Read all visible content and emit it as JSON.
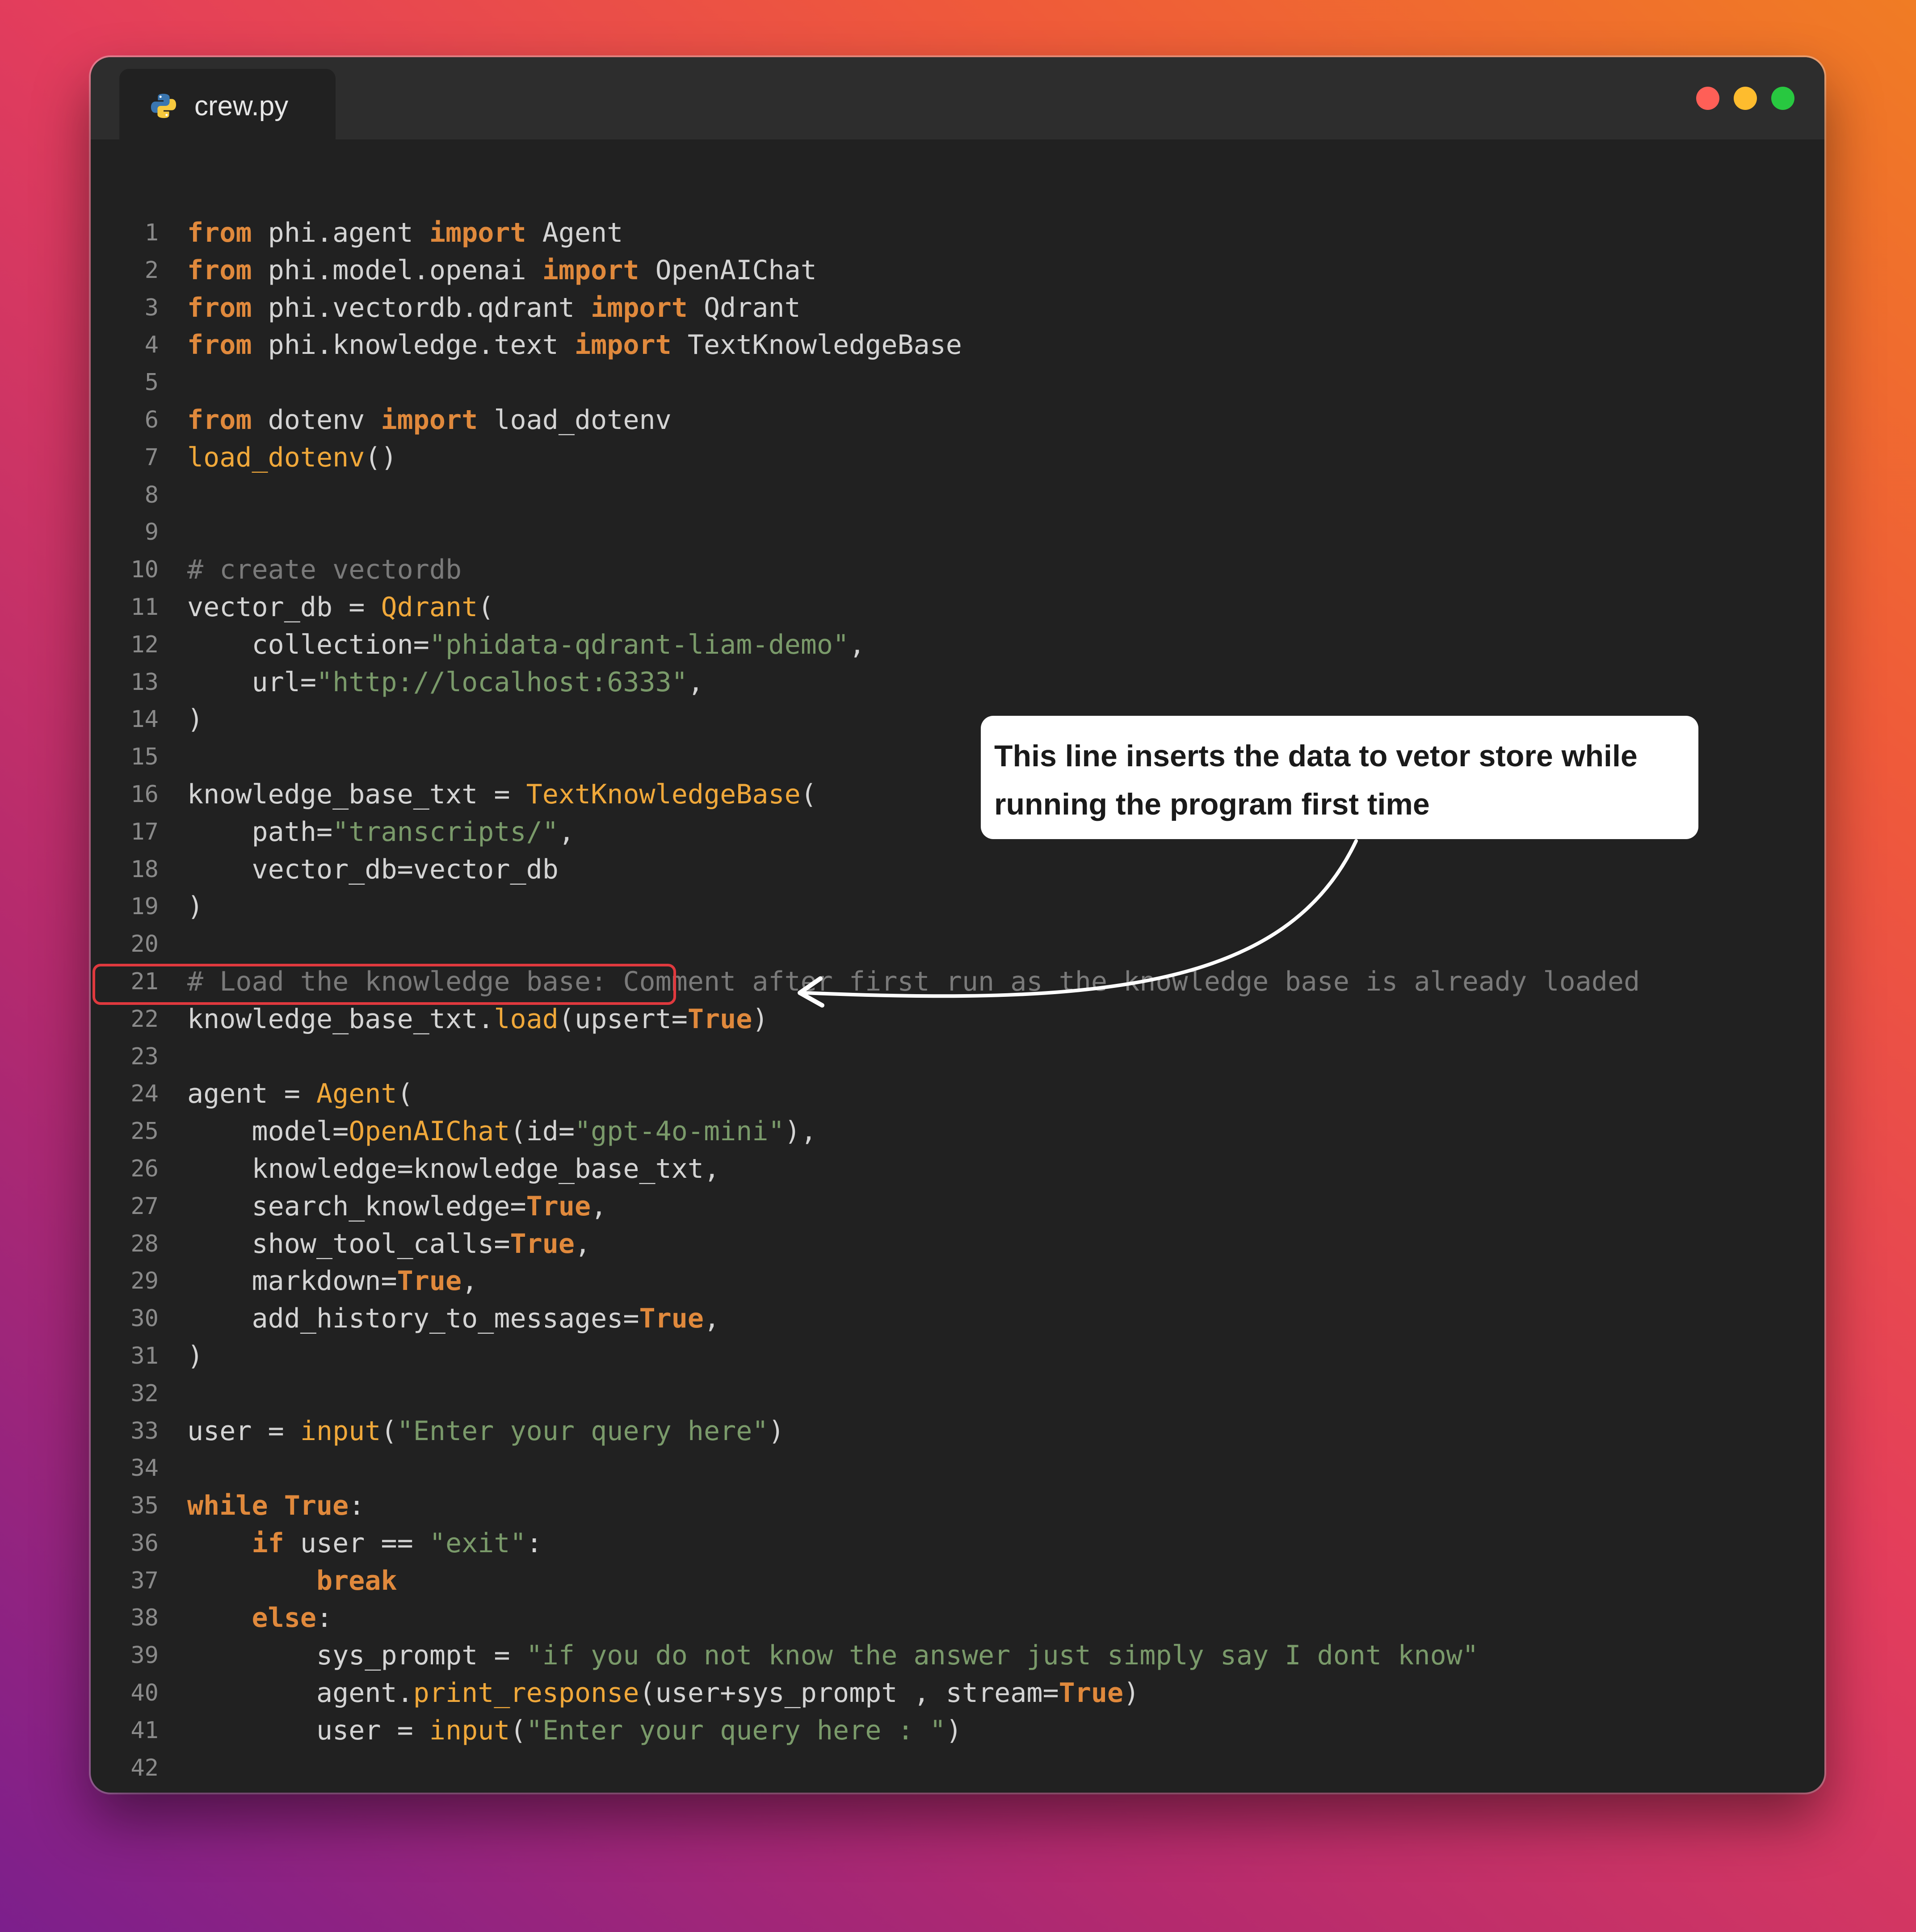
{
  "window": {
    "tab": {
      "filename": "crew.py",
      "icon": "python-icon"
    },
    "controls": {
      "close_color": "#ff5f57",
      "minimize_color": "#febc2e",
      "maximize_color": "#28c840"
    }
  },
  "editor": {
    "highlighted_line": 22,
    "lines": [
      {
        "n": "1",
        "tokens": [
          [
            "kw",
            "from"
          ],
          [
            "pl",
            " phi.agent "
          ],
          [
            "kw",
            "import"
          ],
          [
            "pl",
            " Agent"
          ]
        ]
      },
      {
        "n": "2",
        "tokens": [
          [
            "kw",
            "from"
          ],
          [
            "pl",
            " phi.model.openai "
          ],
          [
            "kw",
            "import"
          ],
          [
            "pl",
            " OpenAIChat"
          ]
        ]
      },
      {
        "n": "3",
        "tokens": [
          [
            "kw",
            "from"
          ],
          [
            "pl",
            " phi.vectordb.qdrant "
          ],
          [
            "kw",
            "import"
          ],
          [
            "pl",
            " Qdrant"
          ]
        ]
      },
      {
        "n": "4",
        "tokens": [
          [
            "kw",
            "from"
          ],
          [
            "pl",
            " phi.knowledge.text "
          ],
          [
            "kw",
            "import"
          ],
          [
            "pl",
            " TextKnowledgeBase"
          ]
        ]
      },
      {
        "n": "5",
        "tokens": []
      },
      {
        "n": "6",
        "tokens": [
          [
            "kw",
            "from"
          ],
          [
            "pl",
            " dotenv "
          ],
          [
            "kw",
            "import"
          ],
          [
            "pl",
            " load_dotenv"
          ]
        ]
      },
      {
        "n": "7",
        "tokens": [
          [
            "fn",
            "load_dotenv"
          ],
          [
            "pl",
            "()"
          ]
        ]
      },
      {
        "n": "8",
        "tokens": []
      },
      {
        "n": "9",
        "tokens": []
      },
      {
        "n": "10",
        "tokens": [
          [
            "cm",
            "# create vectordb"
          ]
        ]
      },
      {
        "n": "11",
        "tokens": [
          [
            "pl",
            "vector_db = "
          ],
          [
            "cls",
            "Qdrant"
          ],
          [
            "pl",
            "("
          ]
        ]
      },
      {
        "n": "12",
        "tokens": [
          [
            "pl",
            "    collection="
          ],
          [
            "str",
            "\"phidata-qdrant-liam-demo\""
          ],
          [
            "pl",
            ","
          ]
        ]
      },
      {
        "n": "13",
        "tokens": [
          [
            "pl",
            "    url="
          ],
          [
            "str",
            "\"http://localhost:6333\""
          ],
          [
            "pl",
            ","
          ]
        ]
      },
      {
        "n": "14",
        "tokens": [
          [
            "pl",
            ")"
          ]
        ]
      },
      {
        "n": "15",
        "tokens": []
      },
      {
        "n": "16",
        "tokens": [
          [
            "pl",
            "knowledge_base_txt = "
          ],
          [
            "cls",
            "TextKnowledgeBase"
          ],
          [
            "pl",
            "("
          ]
        ]
      },
      {
        "n": "17",
        "tokens": [
          [
            "pl",
            "    path="
          ],
          [
            "str",
            "\"transcripts/\""
          ],
          [
            "pl",
            ","
          ]
        ]
      },
      {
        "n": "18",
        "tokens": [
          [
            "pl",
            "    vector_db=vector_db"
          ]
        ]
      },
      {
        "n": "19",
        "tokens": [
          [
            "pl",
            ")"
          ]
        ]
      },
      {
        "n": "20",
        "tokens": []
      },
      {
        "n": "21",
        "tokens": [
          [
            "cm",
            "# Load the knowledge base: Comment after first run as the knowledge base is already loaded"
          ]
        ]
      },
      {
        "n": "22",
        "tokens": [
          [
            "pl",
            "knowledge_base_txt."
          ],
          [
            "fn",
            "load"
          ],
          [
            "pl",
            "(upsert="
          ],
          [
            "kw",
            "True"
          ],
          [
            "pl",
            ")"
          ]
        ]
      },
      {
        "n": "23",
        "tokens": []
      },
      {
        "n": "24",
        "tokens": [
          [
            "pl",
            "agent = "
          ],
          [
            "cls",
            "Agent"
          ],
          [
            "pl",
            "("
          ]
        ]
      },
      {
        "n": "25",
        "tokens": [
          [
            "pl",
            "    model="
          ],
          [
            "cls",
            "OpenAIChat"
          ],
          [
            "pl",
            "(id="
          ],
          [
            "str",
            "\"gpt-4o-mini\""
          ],
          [
            "pl",
            "),"
          ]
        ]
      },
      {
        "n": "26",
        "tokens": [
          [
            "pl",
            "    knowledge=knowledge_base_txt,"
          ]
        ]
      },
      {
        "n": "27",
        "tokens": [
          [
            "pl",
            "    search_knowledge="
          ],
          [
            "kw",
            "True"
          ],
          [
            "pl",
            ","
          ]
        ]
      },
      {
        "n": "28",
        "tokens": [
          [
            "pl",
            "    show_tool_calls="
          ],
          [
            "kw",
            "True"
          ],
          [
            "pl",
            ","
          ]
        ]
      },
      {
        "n": "29",
        "tokens": [
          [
            "pl",
            "    markdown="
          ],
          [
            "kw",
            "True"
          ],
          [
            "pl",
            ","
          ]
        ]
      },
      {
        "n": "30",
        "tokens": [
          [
            "pl",
            "    add_history_to_messages="
          ],
          [
            "kw",
            "True"
          ],
          [
            "pl",
            ","
          ]
        ]
      },
      {
        "n": "31",
        "tokens": [
          [
            "pl",
            ")"
          ]
        ]
      },
      {
        "n": "32",
        "tokens": []
      },
      {
        "n": "33",
        "tokens": [
          [
            "pl",
            "user = "
          ],
          [
            "fn",
            "input"
          ],
          [
            "pl",
            "("
          ],
          [
            "str",
            "\"Enter your query here\""
          ],
          [
            "pl",
            ")"
          ]
        ]
      },
      {
        "n": "34",
        "tokens": []
      },
      {
        "n": "35",
        "tokens": [
          [
            "kw",
            "while"
          ],
          [
            "pl",
            " "
          ],
          [
            "kw",
            "True"
          ],
          [
            "pl",
            ":"
          ]
        ]
      },
      {
        "n": "36",
        "tokens": [
          [
            "pl",
            "    "
          ],
          [
            "kw",
            "if"
          ],
          [
            "pl",
            " user == "
          ],
          [
            "str",
            "\"exit\""
          ],
          [
            "pl",
            ":"
          ]
        ]
      },
      {
        "n": "37",
        "tokens": [
          [
            "pl",
            "        "
          ],
          [
            "kw",
            "break"
          ]
        ]
      },
      {
        "n": "38",
        "tokens": [
          [
            "pl",
            "    "
          ],
          [
            "kw",
            "else"
          ],
          [
            "pl",
            ":"
          ]
        ]
      },
      {
        "n": "39",
        "tokens": [
          [
            "pl",
            "        sys_prompt = "
          ],
          [
            "str",
            "\"if you do not know the answer just simply say I dont know\""
          ]
        ]
      },
      {
        "n": "40",
        "tokens": [
          [
            "pl",
            "        agent."
          ],
          [
            "fn",
            "print_response"
          ],
          [
            "pl",
            "(user+sys_prompt , stream="
          ],
          [
            "kw",
            "True"
          ],
          [
            "pl",
            ")"
          ]
        ]
      },
      {
        "n": "41",
        "tokens": [
          [
            "pl",
            "        user = "
          ],
          [
            "fn",
            "input"
          ],
          [
            "pl",
            "("
          ],
          [
            "str",
            "\"Enter your query here : \""
          ],
          [
            "pl",
            ")"
          ]
        ]
      },
      {
        "n": "42",
        "tokens": []
      }
    ]
  },
  "annotation": {
    "callout_text": "This line inserts the data to vetor store while running the program first time",
    "box_color": "#e0393e",
    "arrow_color": "#ffffff"
  }
}
